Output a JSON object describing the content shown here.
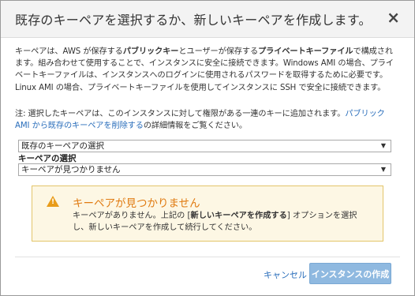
{
  "dialog": {
    "title": "既存のキーペアを選択するか、新しいキーペアを作成します。",
    "close_label": "×"
  },
  "description": {
    "line1_a": "キーペアは、AWS が保存する",
    "line1_b": "パブリックキー",
    "line1_c": "とユーザーが保存する",
    "line1_d": "プライベートキーファイル",
    "line1_e": "で構成されます。",
    "rest": "組み合わせて使用することで、インスタンスに安全に接続できます。Windows AMI の場合、プライベートキーファイルは、インスタンスへのログインに使用されるパスワードを取得するために必要です。Linux AMI の場合、プライベートキーファイルを使用してインスタンスに SSH で安全に接続できます。"
  },
  "note": {
    "prefix": "注: 選択したキーペアは、このインスタンスに対して権限がある一連のキーに追加されます。",
    "link": "パブリック AMI から既存のキーペアを削除する",
    "suffix": "の詳細情報をご覧ください。"
  },
  "selects": {
    "mode_value": "既存のキーペアの選択",
    "keypair_label": "キーペアの選択",
    "keypair_value": "キーペアが見つかりません",
    "arrow": "▼"
  },
  "warning": {
    "icon": "warning-triangle",
    "title": "キーペアが見つかりません",
    "text_a": "キーペアがありません。上記の [",
    "text_b": "新しいキーペアを作成する",
    "text_c": "] オプションを選択し、新しいキーペアを作成して続行してください。",
    "color_accent": "#e07b12"
  },
  "footer": {
    "cancel_label": "キャンセル",
    "launch_label": "インスタンスの作成"
  }
}
